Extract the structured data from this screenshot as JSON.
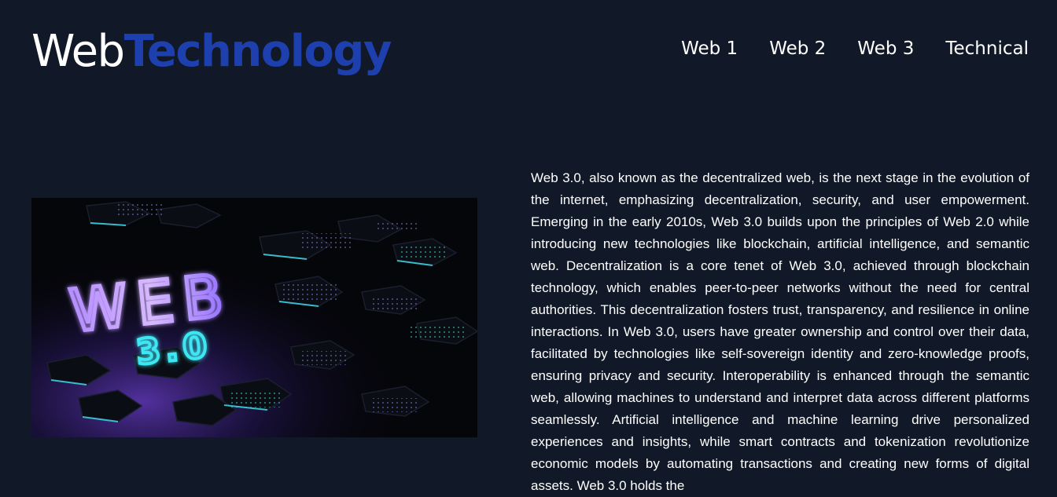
{
  "header": {
    "logo_part1": "Web",
    "logo_part2": "Technology",
    "nav": [
      {
        "label": "Web 1"
      },
      {
        "label": "Web 2"
      },
      {
        "label": "Web 3"
      },
      {
        "label": "Technical"
      }
    ]
  },
  "main": {
    "image": {
      "text_web": "WEB",
      "text_version": "3.0"
    },
    "description": "Web 3.0, also known as the decentralized web, is the next stage in the evolution of the internet, emphasizing decentralization, security, and user empowerment. Emerging in the early 2010s, Web 3.0 builds upon the principles of Web 2.0 while introducing new technologies like blockchain, artificial intelligence, and semantic web. Decentralization is a core tenet of Web 3.0, achieved through blockchain technology, which enables peer-to-peer networks without the need for central authorities. This decentralization fosters trust, transparency, and resilience in online interactions. In Web 3.0, users have greater ownership and control over their data, facilitated by technologies like self-sovereign identity and zero-knowledge proofs, ensuring privacy and security. Interoperability is enhanced through the semantic web, allowing machines to understand and interpret data across different platforms seamlessly. Artificial intelligence and machine learning drive personalized experiences and insights, while smart contracts and tokenization revolutionize economic models by automating transactions and creating new forms of digital assets. Web 3.0 holds the"
  },
  "colors": {
    "background": "#111827",
    "logo_accent": "#1e40af",
    "text": "#ffffff"
  }
}
